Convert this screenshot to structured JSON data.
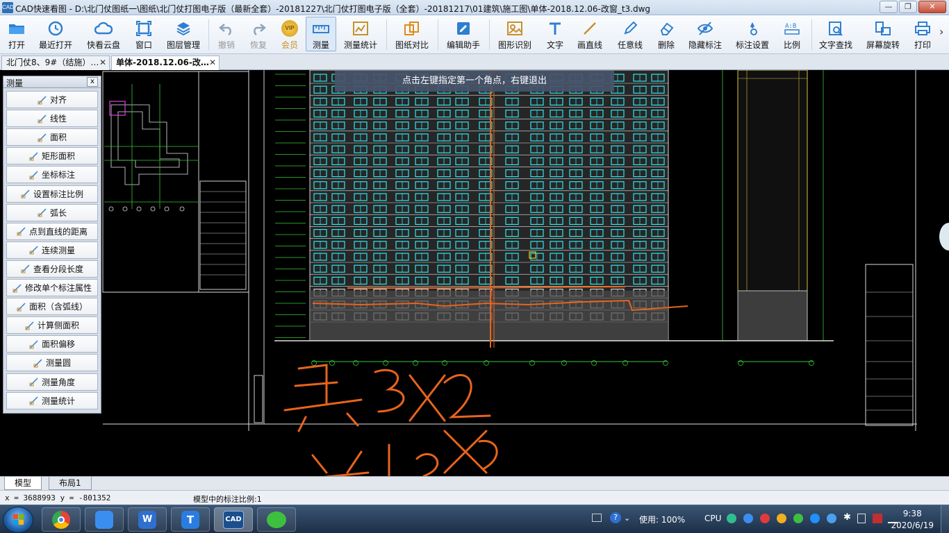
{
  "window": {
    "app_icon": "CAD",
    "title": "CAD快速看图 - D:\\北门仗图纸一\\图纸\\北门仗打图电子版（最新全套）-20181227\\北门仗打图电子版（全套）-20181217\\01建筑\\施工图\\单体-2018.12.06-改窗_t3.dwg",
    "min": "—",
    "max": "❐",
    "close": "✕"
  },
  "toolbar": {
    "items": [
      {
        "label": "打开",
        "icon": "folder-icon"
      },
      {
        "label": "最近打开",
        "icon": "clock-icon"
      },
      {
        "label": "快看云盘",
        "icon": "cloud-icon"
      },
      {
        "label": "窗口",
        "icon": "window-icon"
      },
      {
        "label": "图层管理",
        "icon": "layers-icon"
      },
      {
        "label": "撤销",
        "icon": "undo-icon"
      },
      {
        "label": "恢复",
        "icon": "redo-icon"
      },
      {
        "label": "会员",
        "icon": "vip-icon"
      },
      {
        "label": "测量",
        "icon": "ruler-icon"
      },
      {
        "label": "测量统计",
        "icon": "measure-stats-icon"
      },
      {
        "label": "图纸对比",
        "icon": "compare-icon"
      },
      {
        "label": "编辑助手",
        "icon": "edit-helper-icon"
      },
      {
        "label": "图形识别",
        "icon": "shape-recognize-icon"
      },
      {
        "label": "文字",
        "icon": "text-icon"
      },
      {
        "label": "画直线",
        "icon": "line-icon"
      },
      {
        "label": "任意线",
        "icon": "pen-icon"
      },
      {
        "label": "删除",
        "icon": "eraser-icon"
      },
      {
        "label": "隐藏标注",
        "icon": "hide-eye-icon"
      },
      {
        "label": "标注设置",
        "icon": "annotation-settings-icon"
      },
      {
        "label": "比例",
        "icon": "scale-icon"
      },
      {
        "label": "文字查找",
        "icon": "text-search-icon"
      },
      {
        "label": "屏幕旋转",
        "icon": "rotate-screen-icon"
      },
      {
        "label": "打印",
        "icon": "printer-icon"
      }
    ],
    "vip_badge": "VIP",
    "more": "›"
  },
  "tabs": [
    {
      "label": "北门仗8、9#（结施）…",
      "close": "✕"
    },
    {
      "label": "单体-2018.12.06-改…",
      "close": "✕"
    }
  ],
  "canvas": {
    "tip": "点击左键指定第一个角点，右键退出",
    "background": "#000000"
  },
  "measure_panel": {
    "title": "测量",
    "close": "x",
    "items": [
      {
        "label": "对齐",
        "icon": "align-measure-icon"
      },
      {
        "label": "线性",
        "icon": "linear-measure-icon"
      },
      {
        "label": "面积",
        "icon": "area-icon"
      },
      {
        "label": "矩形面积",
        "icon": "rect-area-icon"
      },
      {
        "label": "坐标标注",
        "icon": "coordinate-icon"
      },
      {
        "label": "设置标注比例",
        "icon": "set-scale-icon"
      },
      {
        "label": "弧长",
        "icon": "arc-length-icon"
      },
      {
        "label": "点到直线的距离",
        "icon": "point-line-distance-icon"
      },
      {
        "label": "连续测量",
        "icon": "continuous-measure-icon"
      },
      {
        "label": "查看分段长度",
        "icon": "segment-length-icon"
      },
      {
        "label": "修改单个标注属性",
        "icon": "edit-annotation-icon"
      },
      {
        "label": "面积（含弧线）",
        "icon": "area-arc-icon"
      },
      {
        "label": "计算侧面积",
        "icon": "side-area-icon"
      },
      {
        "label": "面积偏移",
        "icon": "area-offset-icon"
      },
      {
        "label": "测量圆",
        "icon": "circle-measure-icon"
      },
      {
        "label": "测量角度",
        "icon": "angle-icon"
      },
      {
        "label": "测量统计",
        "icon": "measure-stats-icon"
      }
    ]
  },
  "layout_tabs": [
    {
      "label": "模型"
    },
    {
      "label": "布局1"
    }
  ],
  "status": {
    "coords": "x = 3688993  y = -801352",
    "scale": "模型中的标注比例:1"
  },
  "taskbar": {
    "apps": [
      {
        "name": "chrome-icon"
      },
      {
        "name": "feishu-icon"
      },
      {
        "name": "wps-icon"
      },
      {
        "name": "text-app-icon"
      },
      {
        "name": "cad-icon",
        "label": "CAD"
      },
      {
        "name": "wechat-icon"
      }
    ],
    "tray": {
      "usage": "使用: 100%",
      "cpu": "CPU",
      "time": "9:38",
      "date": "2020/6/19"
    }
  },
  "colors": {
    "accent": "#2f6fb5",
    "drawing_orange": "#e8641c",
    "drawing_cyan": "#2ee6f0",
    "drawing_green": "#37c837"
  }
}
